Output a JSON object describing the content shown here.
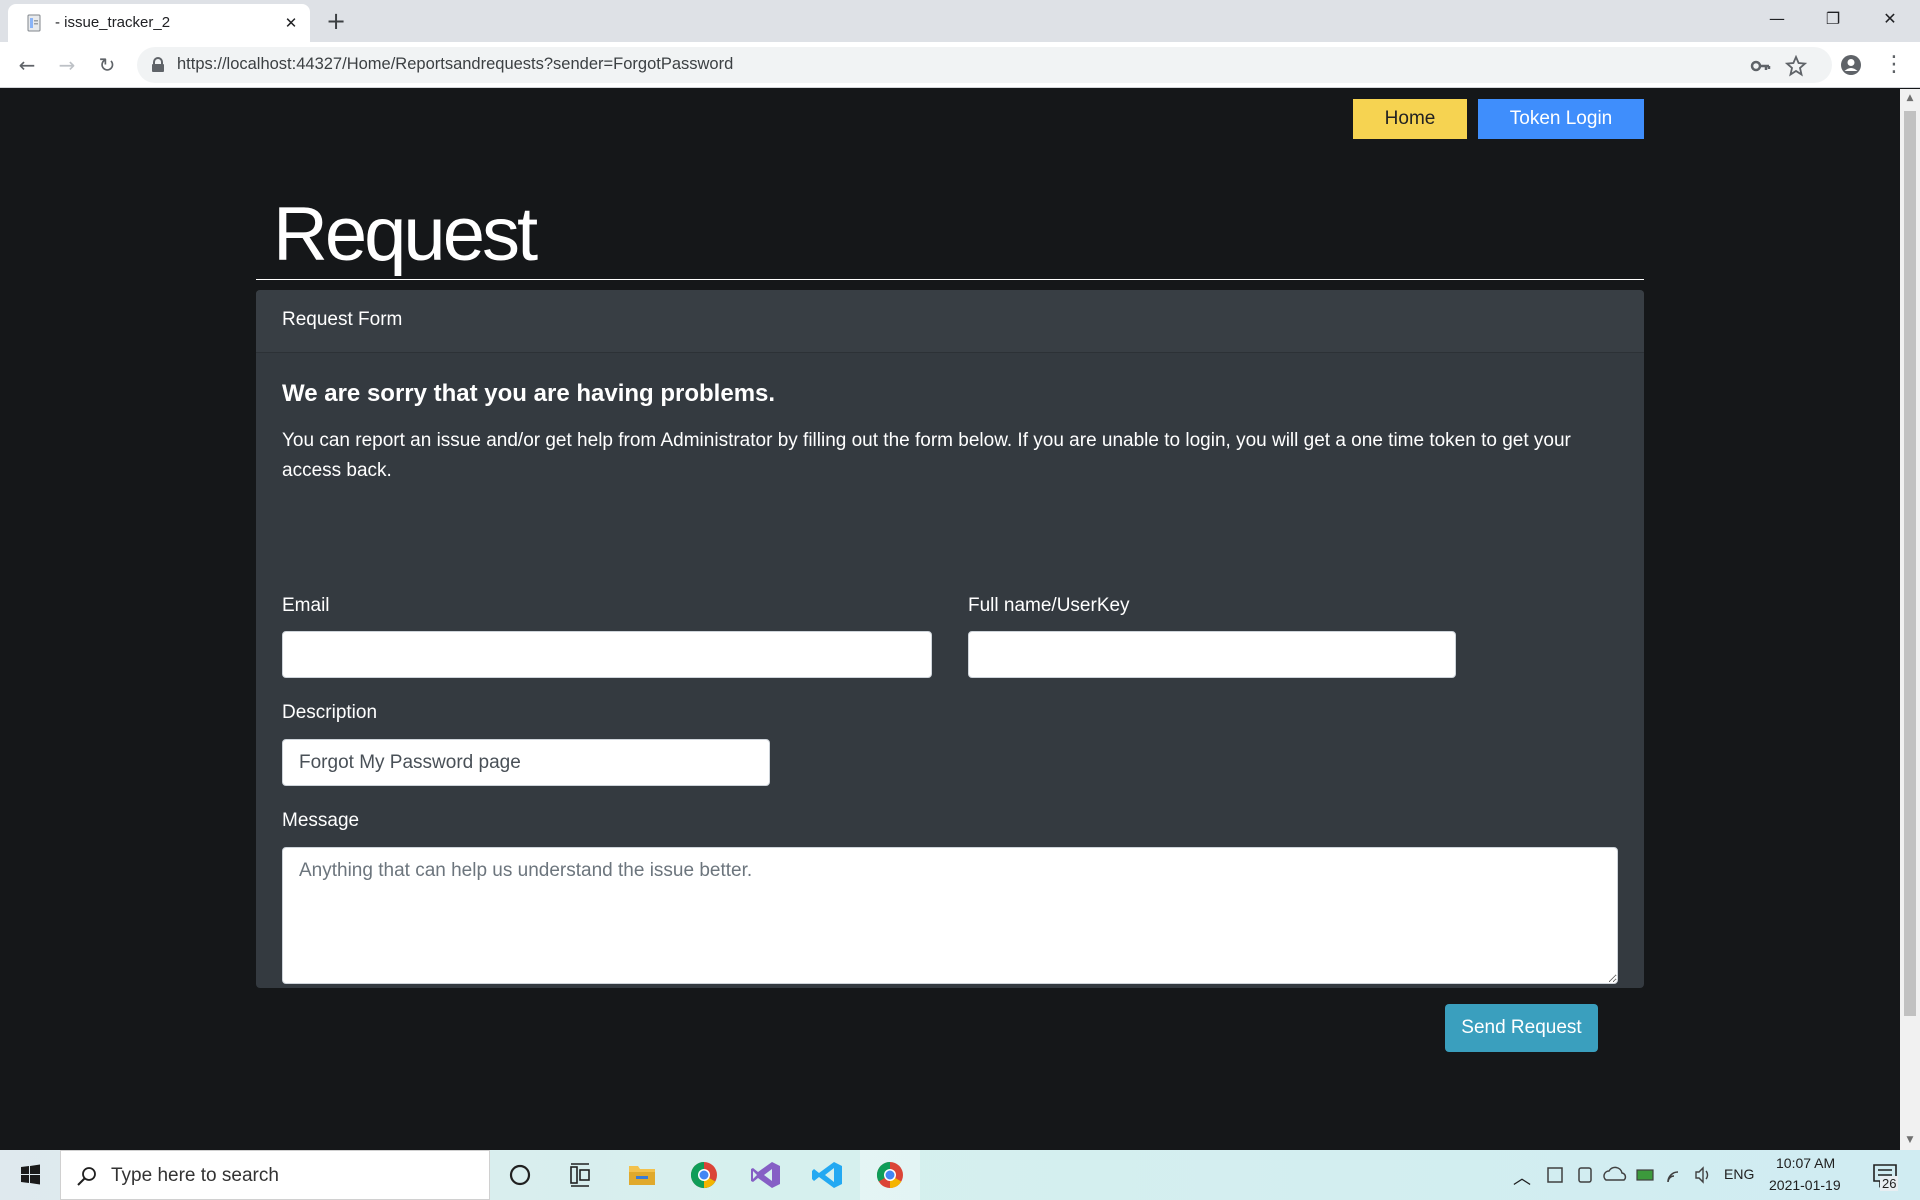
{
  "browser": {
    "tab_title": "- issue_tracker_2",
    "url": "https://localhost:44327/Home/Reportsandrequests?sender=ForgotPassword"
  },
  "nav": {
    "home_label": "Home",
    "token_login_label": "Token Login"
  },
  "page": {
    "heading": "Request",
    "card_header": "Request Form",
    "card_title": "We are sorry that you are having problems.",
    "card_text": "You can report an issue and/or get help from Administrator by filling out the form below. If you are unable to login, you will get a one time token to get your access back."
  },
  "form": {
    "email_label": "Email",
    "email_value": "",
    "fullname_label": "Full name/UserKey",
    "fullname_value": "",
    "description_label": "Description",
    "description_value": "Forgot My Password page",
    "message_label": "Message",
    "message_placeholder": "Anything that can help us understand the issue better.",
    "submit_label": "Send Request"
  },
  "taskbar": {
    "search_placeholder": "Type here to search",
    "language": "ENG",
    "time": "10:07 AM",
    "date": "2021-01-19",
    "notification_count": "26"
  },
  "colors": {
    "page_bg": "#151719",
    "card_bg": "#343a40",
    "home_btn": "#f6d351",
    "token_btn": "#3f8efc",
    "send_btn": "#3a9fbe"
  }
}
